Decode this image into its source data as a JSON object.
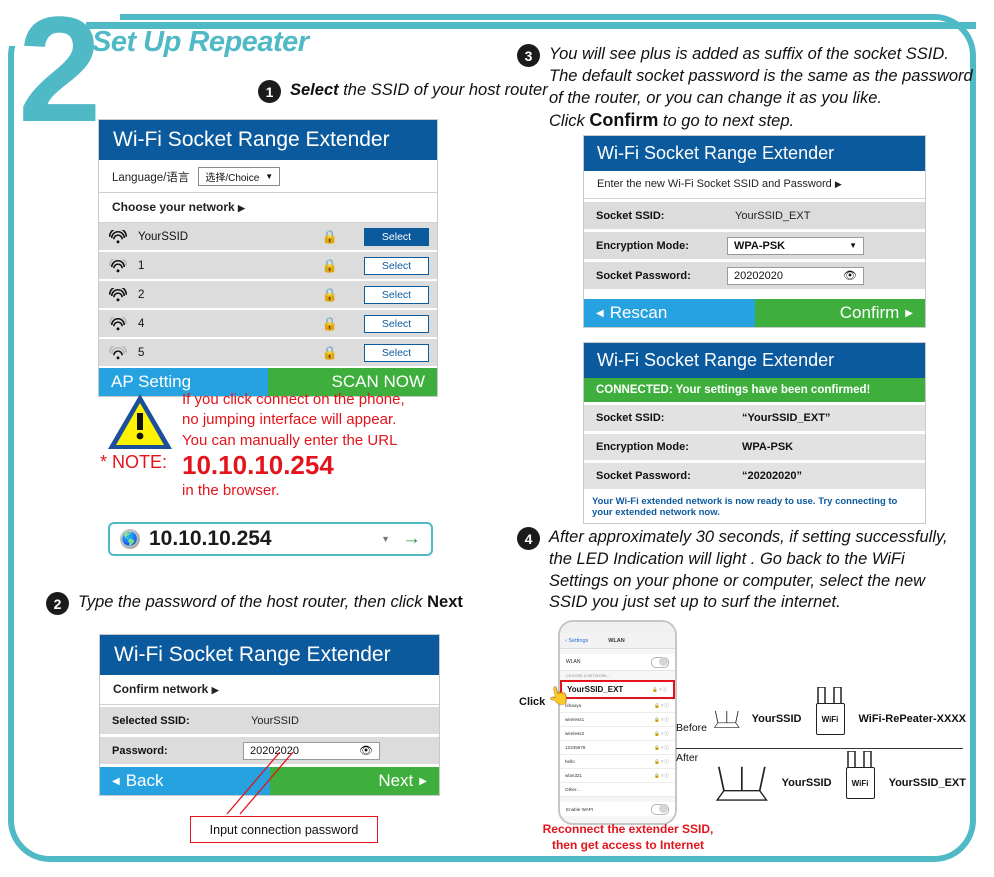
{
  "section": {
    "number": "2",
    "title": "Set Up Repeater",
    "accent_color": "#4FB9C6"
  },
  "steps": {
    "one": {
      "marker": "1",
      "bold": "Select",
      "rest": " the SSID of your host router"
    },
    "two": {
      "marker": "2",
      "text_a": "Type the password of the host router,  then click ",
      "bold_b": "Next"
    },
    "three": {
      "marker": "3",
      "line1": "You will see plus is added as suffix of the socket SSID.",
      "line2": "The default socket password is the same as the password",
      "line3": "of the router, or you can change it as you like.",
      "line4_a": "Click ",
      "line4_bold": "Confirm",
      "line4_b": " to go to next step."
    },
    "four": {
      "marker": "4",
      "line1": "After approximately 30 seconds, if setting successfully,",
      "line2": "the LED Indication will light . Go back to the WiFi",
      "line3": "Settings on your phone or computer, select the new",
      "line4": "SSID you just set up to surf the internet."
    }
  },
  "panel_scan": {
    "title": "Wi-Fi Socket Range Extender",
    "language_label": "Language/语言",
    "language_value": "选择/Choice",
    "choose_network": "Choose your network",
    "networks": [
      {
        "ssid": "YourSSID",
        "lock": "🔒",
        "button": "Select",
        "selected": true,
        "signal": 4
      },
      {
        "ssid": "1",
        "lock": "🔒",
        "button": "Select",
        "selected": false,
        "signal": 3
      },
      {
        "ssid": "2",
        "lock": "🔒",
        "button": "Select",
        "selected": false,
        "signal": 4
      },
      {
        "ssid": "4",
        "lock": "🔒",
        "button": "Select",
        "selected": false,
        "signal": 3
      },
      {
        "ssid": "5",
        "lock": "🔒",
        "button": "Select",
        "selected": false,
        "signal": 2
      }
    ],
    "footer_left": "AP Setting",
    "footer_right": "SCAN NOW"
  },
  "note": {
    "label": "* NOTE:",
    "line1": "If you click connect on the phone,",
    "line2": "no jumping interface will appear.",
    "line3": "You can manually enter the URL",
    "ip": "10.10.10.254",
    "line4": "in the browser."
  },
  "urlbar": {
    "url": "10.10.10.254",
    "caret": "▼",
    "go": "→"
  },
  "panel_password": {
    "title": "Wi-Fi Socket Range Extender",
    "subheading": "Confirm network",
    "rows": [
      {
        "label": "Selected SSID:",
        "value": "YourSSID",
        "type": "text"
      },
      {
        "label": "Password:",
        "value": "20202020",
        "type": "password"
      }
    ],
    "footer_left": "Back",
    "footer_right": "Next"
  },
  "callout": {
    "text": "Input connection password"
  },
  "panel_setup": {
    "title": "Wi-Fi Socket Range Extender",
    "subheading": "Enter the new Wi-Fi Socket SSID and Password",
    "rows": [
      {
        "label": "Socket SSID:",
        "value": "YourSSID_EXT",
        "type": "text"
      },
      {
        "label": "Encryption Mode:",
        "value": "WPA-PSK",
        "type": "select"
      },
      {
        "label": "Socket Password:",
        "value": "20202020",
        "type": "password"
      }
    ],
    "footer_left": "Rescan",
    "footer_right": "Confirm"
  },
  "panel_connected": {
    "title": "Wi-Fi Socket Range Extender",
    "banner": "CONNECTED: Your settings have been confirmed!",
    "rows": [
      {
        "label": "Socket SSID:",
        "value": "“YourSSID_EXT”"
      },
      {
        "label": "Encryption Mode:",
        "value": "WPA-PSK"
      },
      {
        "label": "Socket Password:",
        "value": "“20202020”"
      }
    ],
    "note": "Your Wi-Fi extended network is now ready to use. Try connecting to your extended network now."
  },
  "phone": {
    "back_label": "Settings",
    "title": "WLAN",
    "wlan_label": "WLAN",
    "section_label": "CHOOSE A NETWORK...",
    "highlight_ssid": "YourSSID_EXT",
    "networks": [
      "nihaoya",
      "wireless1",
      "wireless2",
      "12345678",
      "hello",
      "wlan321",
      "Other..."
    ],
    "footer_label": "Enable WAPI",
    "click_label": "Click"
  },
  "diagram": {
    "before_label": "Before",
    "after_label": "After",
    "before_router": "YourSSID",
    "before_extender": "WiFi-RePeater-XXXX",
    "after_router": "YourSSID",
    "after_extender": "YourSSID_EXT",
    "extender_glyph": "WiFi"
  },
  "bottom_note": {
    "line1": "Reconnect the extender SSID,",
    "line2": "then get access to Internet"
  }
}
